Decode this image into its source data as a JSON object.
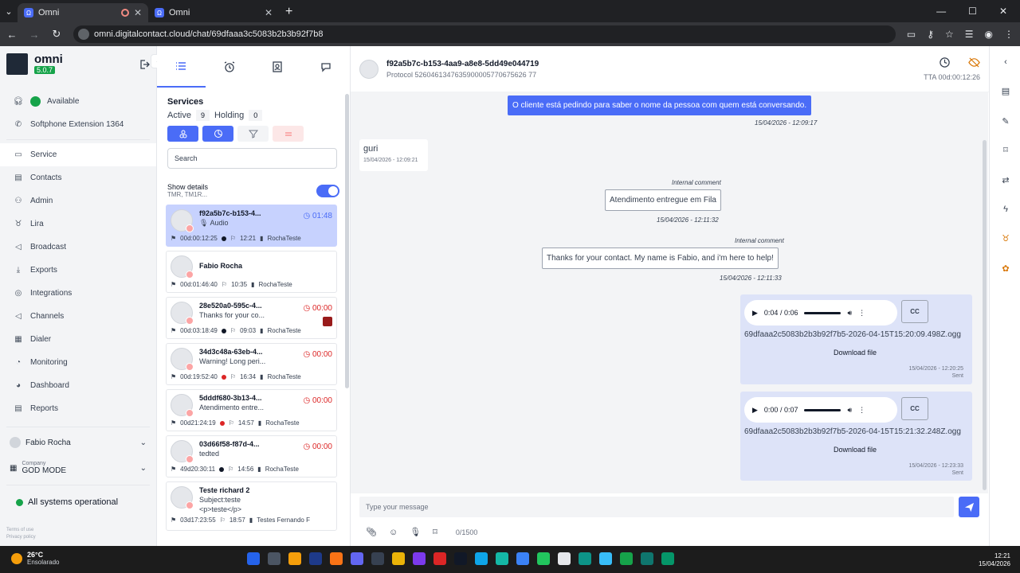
{
  "browser": {
    "tabs": [
      {
        "title": "Omni",
        "icon": "omni-favicon"
      },
      {
        "title": "Omni",
        "icon": "omni-favicon"
      }
    ],
    "new_tab": "+",
    "url": "omni.digitalcontact.cloud/chat/69dfaaa3c5083b2b3b92f7b8"
  },
  "app": {
    "name": "omni",
    "version": "5.0.7"
  },
  "nav": {
    "status": "Available",
    "softphone": "Softphone Extension 1364",
    "items": [
      "Service",
      "Contacts",
      "Admin",
      "Lira",
      "Broadcast",
      "Exports",
      "Integrations",
      "Channels",
      "Dialer",
      "Monitoring",
      "Dashboard",
      "Reports"
    ],
    "user": "Fabio Rocha",
    "company_label": "Company",
    "company": "GOD MODE",
    "systems": "All systems operational",
    "terms": "Terms of use",
    "privacy": "Privacy policy"
  },
  "services": {
    "title": "Services",
    "active_label": "Active",
    "active_count": "9",
    "holding_label": "Holding",
    "holding_count": "0",
    "search_placeholder": "Search",
    "details_label": "Show details",
    "details_sub": "TMR, TM1R...",
    "cards": [
      {
        "name": "f92a5b7c-b153-4...",
        "sub": "Audio",
        "timer": "01:48",
        "time": "00d:00:12:25",
        "msg": "12:21",
        "agent": "RochaTeste"
      },
      {
        "name": "Fabio Rocha",
        "sub": "",
        "timer": "",
        "time": "00d:01:46:40",
        "msg": "10:35",
        "agent": "RochaTeste"
      },
      {
        "name": "28e520a0-595c-4...",
        "sub": "Thanks for your co...",
        "timer": "00:00",
        "time": "00d:03:18:49",
        "msg": "09:03",
        "agent": "RochaTeste"
      },
      {
        "name": "34d3c48a-63eb-4...",
        "sub": "Warning! Long peri...",
        "timer": "00:00",
        "time": "00d:19:52:40",
        "msg": "16:34",
        "agent": "RochaTeste"
      },
      {
        "name": "5dddf680-3b13-4...",
        "sub": "Atendimento entre...",
        "timer": "00:00",
        "time": "00d21:24:19",
        "msg": "14:57",
        "agent": "RochaTeste"
      },
      {
        "name": "03d66f58-f87d-4...",
        "sub": "tedted",
        "timer": "00:00",
        "time": "49d20:30:11",
        "msg": "14:56",
        "agent": "RochaTeste"
      },
      {
        "name": "Teste richard 2",
        "sub": "Subject:teste",
        "sub2": "<p>teste</p>",
        "timer": "",
        "time": "03d17:23:55",
        "msg": "18:57",
        "agent": "Testes Fernando F"
      }
    ]
  },
  "chat": {
    "contact_id": "f92a5b7c-b153-4aa9-a8e8-5dd49e044719",
    "protocol": "Protocol 5260461347635900005770675626 77",
    "tta": "TTA 00d:00:12:26",
    "messages": {
      "m1": {
        "text": "O cliente está pedindo para saber o nome da pessoa com quem está conversando.",
        "time": "15/04/2026 - 12:09:17"
      },
      "m2": {
        "text": "guri",
        "time": "15/04/2026 - 12:09:21"
      },
      "ic_label": "Internal comment",
      "m3": {
        "text": "Atendimento entregue em Fila",
        "time": "15/04/2026 - 12:11:32"
      },
      "m4": {
        "text": "Thanks for your contact. My name is Fabio, and i'm here to help!",
        "time": "15/04/2026 - 12:11:33"
      },
      "a1": {
        "progress": "0:04 / 0:06",
        "file": "69dfaaa2c5083b2b3b92f7b5-2026-04-15T15:20:09.498Z.ogg",
        "time": "15/04/2026 - 12:20:25"
      },
      "a2": {
        "progress": "0:00 / 0:07",
        "file": "69dfaaa2c5083b2b3b92f7b5-2026-04-15T15:21:32.248Z.ogg",
        "time": "15/04/2026 - 12:23:33"
      },
      "download": "Download file",
      "sent": "Sent",
      "cc": "CC"
    },
    "input_placeholder": "Type your message",
    "counter": "0/1500"
  },
  "taskbar": {
    "temp": "26°C",
    "weather": "Ensolarado",
    "time": "12:21",
    "date": "15/04/2026"
  }
}
